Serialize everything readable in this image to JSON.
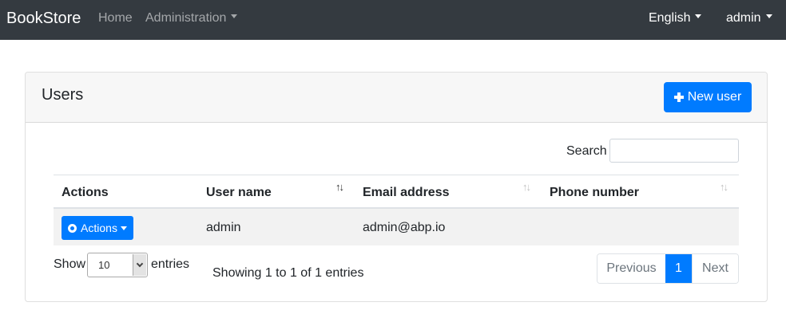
{
  "navbar": {
    "brand": "BookStore",
    "home": "Home",
    "administration": "Administration",
    "language": "English",
    "user": "admin",
    "background": "#343a40"
  },
  "card": {
    "title": "Users",
    "new_user_label": "New user",
    "new_user_icon": "plus-icon"
  },
  "search": {
    "label": "Search",
    "value": "",
    "placeholder": ""
  },
  "table": {
    "columns": [
      "Actions",
      "User name",
      "Email address",
      "Phone number"
    ],
    "rows": [
      {
        "actions_label": "Actions",
        "user_name": "admin",
        "email": "admin@abp.io",
        "phone": ""
      }
    ]
  },
  "footer": {
    "show_label": "Show",
    "page_size": "10",
    "entries_label": "entries",
    "info": "Showing 1 to 1 of 1 entries",
    "previous": "Previous",
    "current_page": "1",
    "next": "Next"
  },
  "colors": {
    "primary": "#007bff"
  }
}
